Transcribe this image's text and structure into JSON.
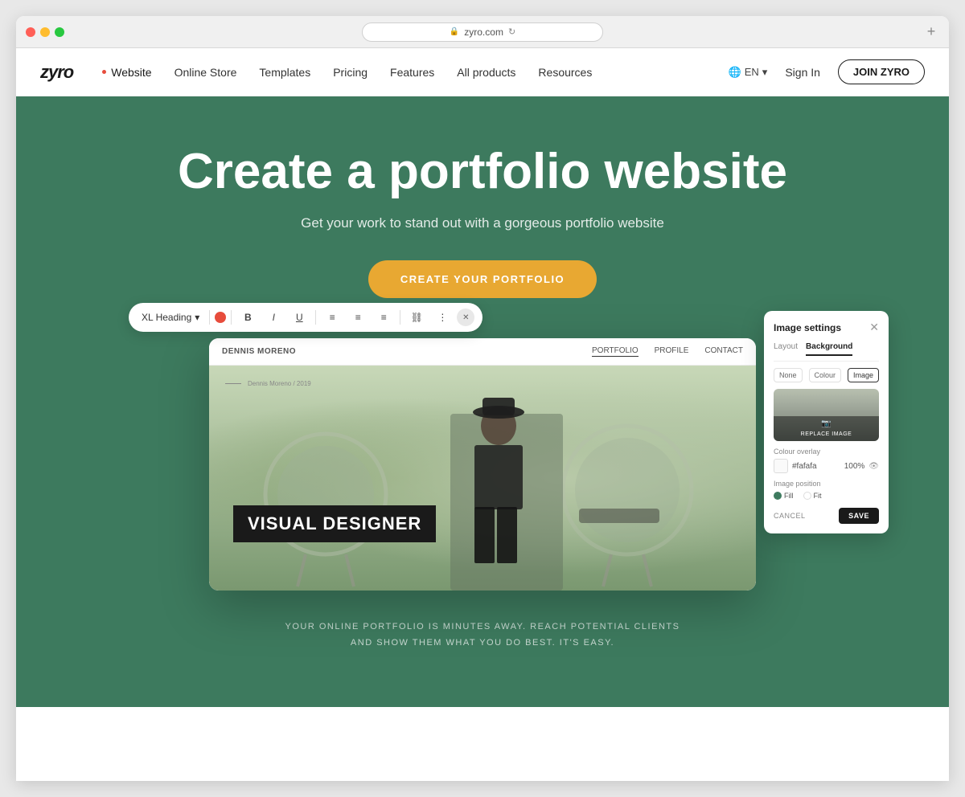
{
  "browser": {
    "url": "zyro.com",
    "new_tab_icon": "+"
  },
  "navbar": {
    "logo": "zyro",
    "nav_items": [
      {
        "label": "Website",
        "active": true
      },
      {
        "label": "Online Store",
        "active": false
      },
      {
        "label": "Templates",
        "active": false
      },
      {
        "label": "Pricing",
        "active": false
      },
      {
        "label": "Features",
        "active": false
      },
      {
        "label": "All products",
        "active": false
      },
      {
        "label": "Resources",
        "active": false
      }
    ],
    "lang": "EN",
    "sign_in": "Sign In",
    "join": "JOIN ZYRO"
  },
  "hero": {
    "title": "Create a portfolio website",
    "subtitle": "Get your work to stand out with a gorgeous portfolio website",
    "cta_label": "CREATE YOUR PORTFOLIO",
    "tagline_line1": "YOUR ONLINE PORTFOLIO IS MINUTES AWAY. REACH POTENTIAL CLIENTS",
    "tagline_line2": "AND SHOW THEM WHAT YOU DO BEST. IT'S EASY."
  },
  "mini_editor": {
    "author": "DENNIS MORENO",
    "nav_items": [
      "PORTFOLIO",
      "PROFILE",
      "CONTACT"
    ],
    "active_nav": "PORTFOLIO",
    "date_line": "Dennis Moreno / 2019",
    "overlay_text": "VISUAL DESIGNER"
  },
  "toolbar": {
    "heading_type": "XL Heading",
    "buttons": [
      "B",
      "I",
      "U",
      "≡",
      "≡",
      "≡",
      "⛓",
      "⋮"
    ]
  },
  "image_settings": {
    "title": "Image settings",
    "tabs": [
      "Layout",
      "Background"
    ],
    "active_tab": "Background",
    "bg_options": [
      "None",
      "Colour",
      "Image"
    ],
    "active_bg": "Image",
    "replace_image_label": "REPLACE IMAGE",
    "colour_overlay_label": "Colour overlay",
    "colour_value": "#fafafa",
    "colour_percent": "100%",
    "image_position_label": "Image position",
    "positions": [
      "Fill",
      "Fit"
    ],
    "active_position": "Fill",
    "cancel_label": "CANCEL",
    "save_label": "SAVE"
  },
  "colors": {
    "hero_bg": "#3d7a5e",
    "cta_btn": "#e8a832",
    "overlay_bg": "#1a1a1a"
  }
}
